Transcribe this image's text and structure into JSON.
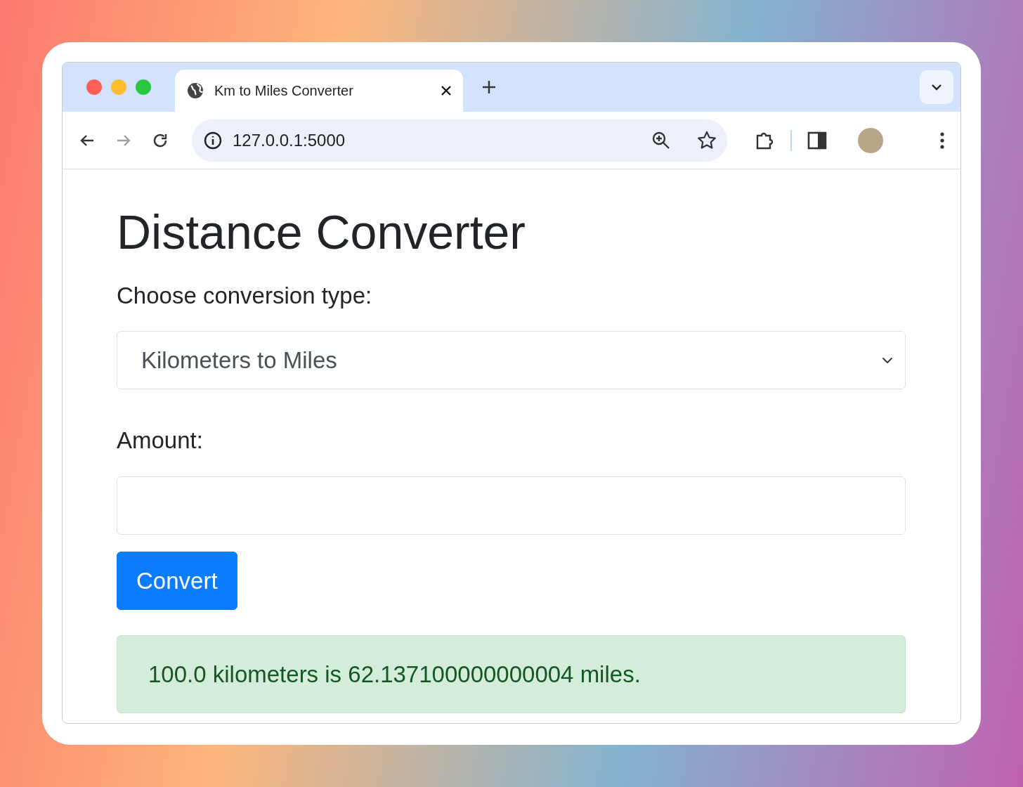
{
  "browser": {
    "tabs": [
      {
        "title": "Km to Miles Converter",
        "selected": true
      }
    ],
    "address": "127.0.0.1:5000",
    "nav": {
      "back_disabled": false,
      "forward_disabled": true
    }
  },
  "page": {
    "heading": "Distance Converter",
    "type_label": "Choose conversion type:",
    "type_value": "Kilometers to Miles",
    "amount_label": "Amount:",
    "button": "Convert",
    "result": "100.0 kilometers is 62.137100000000004 miles."
  }
}
